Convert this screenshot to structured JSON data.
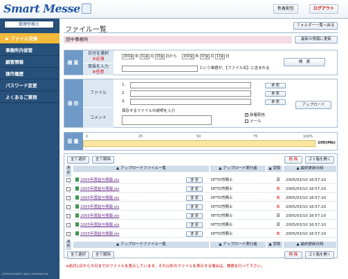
{
  "header": {
    "logo": "Smart Messe",
    "btn_new": "新着配信",
    "btn_logout": "ログアウト"
  },
  "sidebar": {
    "user": "管理労務士",
    "items": [
      {
        "label": "ファイル交換",
        "active": true
      },
      {
        "label": "事務所内保管",
        "active": false
      },
      {
        "label": "顧客情報",
        "active": false
      },
      {
        "label": "操作履歴",
        "active": false
      },
      {
        "label": "パスワード変更",
        "active": false
      },
      {
        "label": "よくあるご質問",
        "active": false
      }
    ],
    "copyright": "COPYRIGHT@NTT DATA CORPORATION"
  },
  "main": {
    "title": "ファイル一覧",
    "folder_btn": "フォルダー一覧へ戻る",
    "office": "田中事務所",
    "refresh_btn": "最新の情報に更新"
  },
  "search": {
    "label": "検索",
    "date_label": "日付を選択",
    "required": "※必須",
    "word_label": "単語を入力",
    "optional": "※任意",
    "from": {
      "year": "2005",
      "month": "02",
      "day": "01"
    },
    "to": {
      "year": "2005",
      "month": "03",
      "day": "11"
    },
    "from_suffix": "日から",
    "to_suffix": "日",
    "year_unit": "年",
    "month_unit": "月",
    "word_hint": "という単語が、【ファイル名】に含まれる",
    "search_btn": "検　索"
  },
  "save": {
    "label": "保存",
    "file_label": "ファイル",
    "comment_label": "コメント",
    "comment_placeholder": "保存するファイルの説明を入力",
    "file_nums": [
      "1.",
      "2.",
      "3."
    ],
    "browse": "参 照",
    "notify_new": "新着配信",
    "notify_mail": "メール",
    "upload_btn": "アップロード"
  },
  "capacity": {
    "label": "容量",
    "ticks": [
      "0",
      "25",
      "50",
      "75",
      "100%"
    ],
    "used_percent": 100,
    "value": "100(Mb)"
  },
  "list": {
    "select_all": "全て選択",
    "deselect_all": "全て解除",
    "delete_btn": "削 除",
    "trash_btn": "ゴミ箱を開く",
    "col_select": "選択",
    "col_file": "アップロードファイル一覧",
    "col_user": "アップロード実行者",
    "col_recv": "受取",
    "col_date": "最終更新日時",
    "change": "変 更",
    "rows": [
      {
        "file": "2005年度給与情報.xls",
        "user": "NTTD労務士",
        "recv": "済",
        "date": "2005/03/10 16:57:10"
      },
      {
        "file": "2005年度給与情報.xls",
        "user": "NTTD労務士",
        "recv": "未",
        "date": "2005/03/10 16:57:10"
      },
      {
        "file": "2005年度給与情報.xls",
        "user": "NTTD労務士",
        "recv": "未",
        "date": "2005/03/10 16:57:10"
      },
      {
        "file": "2005年度給与情報.xls",
        "user": "NTTD労務士",
        "recv": "未",
        "date": "2005/03/10 16:57:10"
      },
      {
        "file": "2005年度給与情報.xls",
        "user": "NTTD労務士",
        "recv": "済",
        "date": "2005/03/10 16:57:10"
      },
      {
        "file": "2005年度給与情報.xls",
        "user": "NTTD労務士",
        "recv": "済",
        "date": "2005/03/10 16:57:10"
      },
      {
        "file": "2005年度給与情報.xls",
        "user": "NTTD労務士",
        "recv": "未",
        "date": "2005/03/10 16:57:10"
      }
    ],
    "note": "※前月1日から今日までのファイルを表示しています。それ以外のファイルを表示する場合は、検索を行って下さい。"
  }
}
